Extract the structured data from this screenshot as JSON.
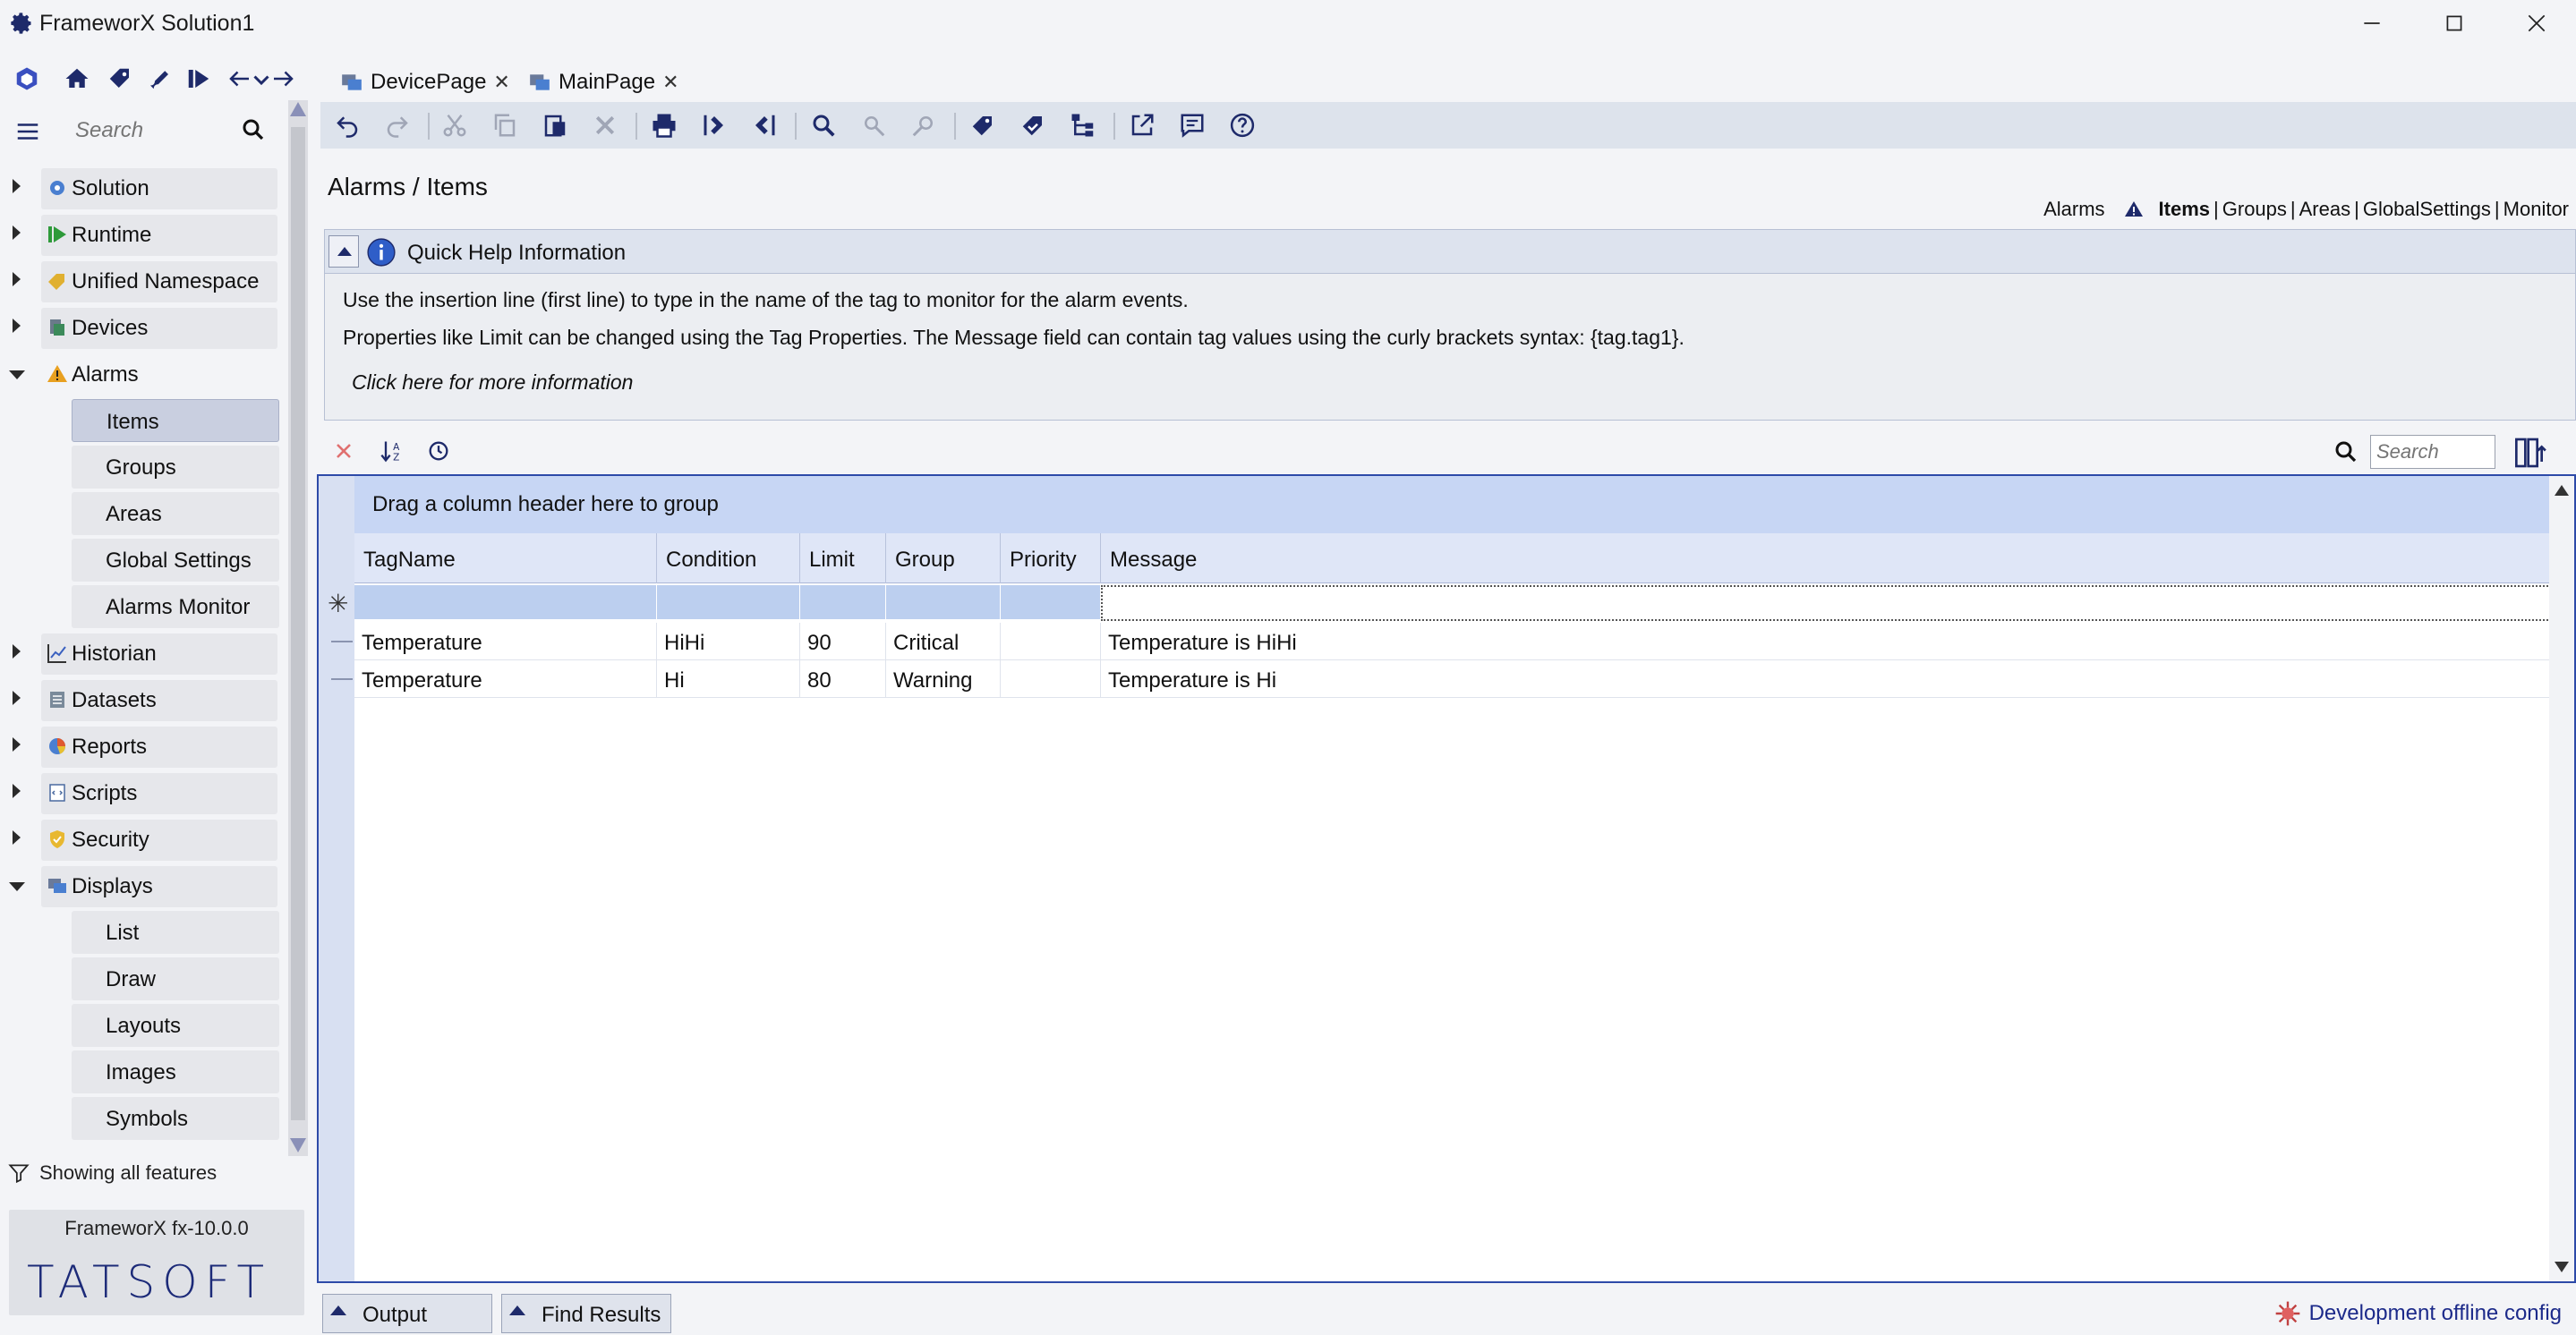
{
  "window": {
    "title": "FrameworX Solution1"
  },
  "sidebar": {
    "search_placeholder": "Search",
    "items": [
      {
        "label": "Solution",
        "icon": "gear-icon"
      },
      {
        "label": "Runtime",
        "icon": "runtime-icon"
      },
      {
        "label": "Unified Namespace",
        "icon": "tag-icon"
      },
      {
        "label": "Devices",
        "icon": "devices-icon"
      },
      {
        "label": "Alarms",
        "icon": "warning-icon"
      },
      {
        "label": "Historian",
        "icon": "chart-icon"
      },
      {
        "label": "Datasets",
        "icon": "dataset-icon"
      },
      {
        "label": "Reports",
        "icon": "pie-icon"
      },
      {
        "label": "Scripts",
        "icon": "script-icon"
      },
      {
        "label": "Security",
        "icon": "shield-icon"
      },
      {
        "label": "Displays",
        "icon": "display-icon"
      }
    ],
    "alarms_children": [
      "Items",
      "Groups",
      "Areas",
      "Global Settings",
      "Alarms Monitor"
    ],
    "displays_children": [
      "List",
      "Draw",
      "Layouts",
      "Images",
      "Symbols"
    ],
    "filter_text": "Showing all features",
    "version": "FrameworX fx-10.0.0",
    "logo": "TATSOFT"
  },
  "tabs": [
    {
      "label": "DevicePage"
    },
    {
      "label": "MainPage"
    }
  ],
  "content": {
    "breadcrumb": "Alarms / Items",
    "subnav": {
      "prefix": "Alarms",
      "items": [
        "Items",
        "Groups",
        "Areas",
        "GlobalSettings",
        "Monitor"
      ],
      "separator": "|"
    },
    "quick_help": {
      "title": "Quick Help Information",
      "line1": "Use the insertion line (first line) to type in the name of the tag to monitor for the alarm events.",
      "line2": "Properties like Limit can be changed using the Tag Properties. The Message field can contain tag values using the curly brackets syntax: {tag.tag1}.",
      "link": "Click here for more information"
    },
    "grid_search_placeholder": "Search",
    "grid": {
      "group_hint": "Drag a column header here to group",
      "new_row_marker": "✳",
      "columns": [
        "TagName",
        "Condition",
        "Limit",
        "Group",
        "Priority",
        "Message"
      ],
      "rows": [
        [
          "Temperature",
          "HiHi",
          "90",
          "Critical",
          "",
          "Temperature is HiHi"
        ],
        [
          "Temperature",
          "Hi",
          "80",
          "Warning",
          "",
          "Temperature is Hi"
        ]
      ]
    }
  },
  "bottom": {
    "tabs": [
      "Output",
      "Find Results"
    ],
    "status": "Development offline config"
  },
  "colors": {
    "accent": "#2d4aa8",
    "toolbar_bg": "#dde3ec",
    "group_panel": "#c7d6f4",
    "status_text": "#1c2a8a"
  }
}
